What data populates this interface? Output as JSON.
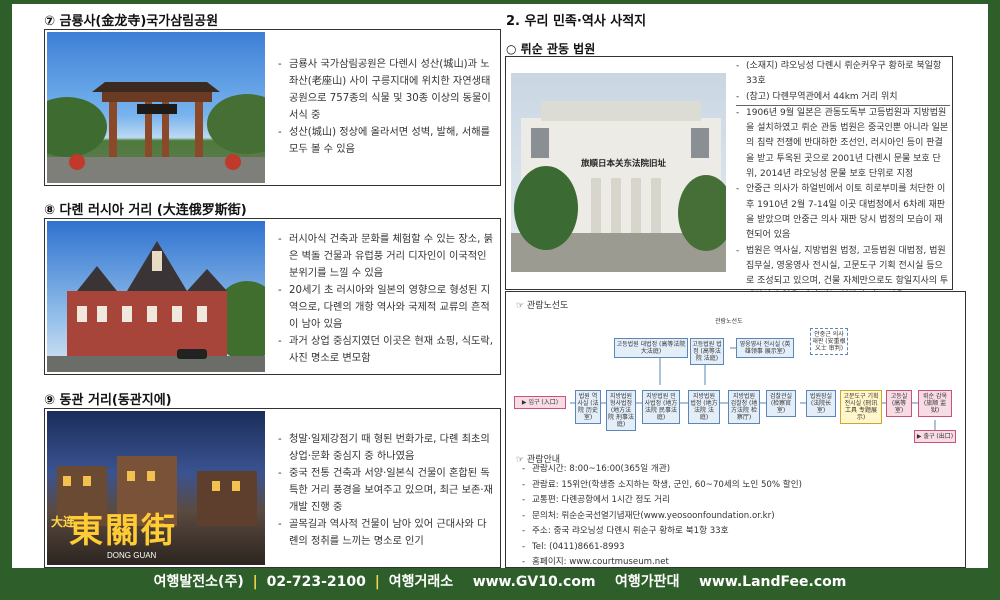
{
  "left": {
    "s7": {
      "title": "⑦ 금룡사(金龙寺)국가삼림공원",
      "items": [
        "금룡사 국가삼림공원은 다렌시 성산(城山)과 노좌산(老座山) 사이 구릉지대에 위치한 자연생태공원으로 757종의 식물 및 30종 이상의 동물이 서식 중",
        "성산(城山) 정상에 올라서면 성벽, 발해, 서해를 모두 볼 수 있음"
      ]
    },
    "s8": {
      "title": "⑧ 다롄 러시아 거리 (大连俄罗斯街)",
      "items": [
        "러시아식 건축과 문화를 체험할 수 있는 장소, 붉은 벽돌 건물과 유럽풍 거리 디자인이 이국적인 분위기를 느낄 수 있음",
        "20세기 초 러시아와 일본의 영향으로 형성된 지역으로, 다롄의 개항 역사와 국제적 교류의 흔적이 남아 있음",
        "과거 상업 중심지였던 이곳은 현재 쇼핑, 식도락, 사진 명소로 변모함"
      ]
    },
    "s9": {
      "title": "⑨ 동관 거리(동관지에)",
      "sign_text": "東關街",
      "sign_small": "大连",
      "sign_bottom": "DONG GUAN",
      "items": [
        "청말·일제강점기 때 형된 번화가로, 다롄 최초의 상업·문화 중심지 중 하나였음",
        "중국 전통 건축과 서양·일본식 건물이 혼합된 독특한 거리 풍경을 보여주고 있으며, 최근 보존·재개발 진행 중",
        "골목길과 역사적 건물이 남아 있어 근대사와 다롄의 정취를 느끼는 명소로 인기"
      ]
    }
  },
  "right": {
    "section_title": "2. 우리 민족·역사 사적지",
    "sub_title": "○ 뤼순 관동 법원",
    "building_sign": "旅順日本关东法院旧址",
    "court_items": [
      "(소재지) 랴오닝성 다롄시 뤼순커우구 황하로 북일항 33호",
      "(참고) 다롄무역관에서 44km 거리 위치",
      "1906년 9월 일본은 관동도독부 고등법원과 지방법원을 설치하였고 뤼순 관동 법원은 중국인뿐 아니라 일본의 침략 전쟁에 반대하한 조선인, 러시아인 등이 판결을 받고 투옥된 곳으로 2001년 다롄시 문물 보호 단위, 2014년 랴오닝성 문물 보호 단위로 지정",
      "안중근 의사가 하얼빈에서 이토 히로부미를 처단한 이후 1910년 2월 7-14일 이곳 대법정에서 6차례 재판을 받았으며 안중근 의사 재판 당시 법정의 모습이 재현되어 있음",
      "법원은 역사실, 지방법원 법정, 고등법원 대법정, 법원 집무실, 영웅영사 전시실, 고문도구 기획 전시실 등으로 조성되고 있으며, 건물 자체만으로도 항일지사의 투쟁정신과 얼을 이어 받는 현장이 되고 있음"
    ],
    "map": {
      "title": "☞ 관람노선도",
      "route_label": "관람노선도",
      "entrance": "▶ 입구 (入口)",
      "exit": "▶ 출구 (出口)",
      "nodes": [
        "법원 역사실 (法院 历史室)",
        "지방법원 형사법정 (地方法院 刑事法庭)",
        "지방법원 민사법정 (地方法院 民事法庭)",
        "고등법원 대법정 (高等法院 大法庭)",
        "지방법원 법정 (地方法院 法庭)",
        "지방법원 검찰청 (地方法院 检察厅)",
        "영웅영사 전시실 (英雄领事 展示室)",
        "안중근 의사 재판 (安重根 义士 审判)",
        "고등법원 법정 (高等法院 法庭)",
        "검찰관실 (检察官室)",
        "법원장실 (法院长室)",
        "고문도구 기획 전시실 (刑讯工具 专题展示)",
        "고등실 (高等室)",
        "뤼순 감옥 (旅顺 监狱)"
      ]
    },
    "info_title": "☞ 관람안내",
    "info_items": [
      "관람시간: 8:00~16:00(365일 개관)",
      "관람료: 15위안(학생증 소지하는 학생, 군인, 60~70세의 노인 50% 할인)",
      "교통편: 다롄공항에서 1시간 정도 거리",
      "문의처: 뤼순순국선열기념재단(www.yeosoonfoundation.or.kr)",
      "주소: 중국 랴오닝성 다롄시 뤼순구 황하로 북1항 33호",
      "Tel: (0411)8661-8993",
      "홈페이지: www.courtmuseum.net"
    ]
  },
  "footer": {
    "company": "여행발전소(주)",
    "phone": "02-723-2100",
    "market": "여행거래소",
    "site1": "www.GV10.com",
    "board": "여행가판대",
    "site2": "www.LandFee.com",
    "sep": "|"
  },
  "colors": {
    "frame_green": "#2e5f2a",
    "separator_yellow": "#f1d84a",
    "map_blue": "#5a86b8",
    "map_pink": "#c7557a",
    "map_yellow": "#c9a832"
  }
}
